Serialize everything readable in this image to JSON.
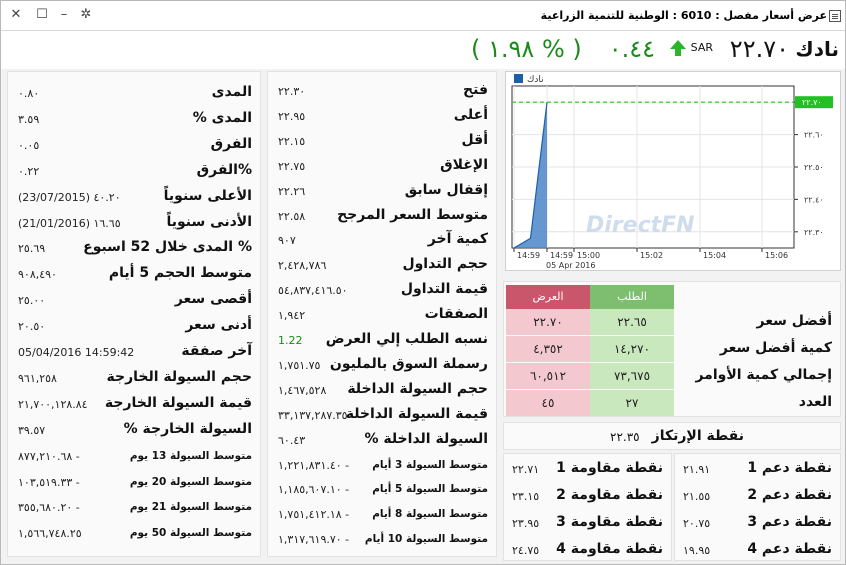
{
  "window": {
    "title": "عرض أسعار مفصل : 6010 : الوطنية للتنمية الزراعية",
    "icon": "grid-icon",
    "controls": [
      "settings-icon",
      "minimize-icon",
      "maximize-icon",
      "close-icon"
    ]
  },
  "header": {
    "name": "نادك",
    "price": "٢٢.٧٠",
    "currency": "SAR",
    "direction_icon": "up-arrow-icon",
    "change": "٠.٤٤",
    "change_pct": "( ١.٩٨ % )",
    "color_up": "#1a8a1a"
  },
  "middle": {
    "rows": [
      {
        "label": "فتح",
        "value": "٢٢.٣٠"
      },
      {
        "label": "أعلى",
        "value": "٢٢.٩٥"
      },
      {
        "label": "أقل",
        "value": "٢٢.١٥"
      },
      {
        "label": "الإغلاق",
        "value": "٢٢.٧٥"
      },
      {
        "label": "إقفال سابق",
        "value": "٢٢.٢٦"
      },
      {
        "label": "متوسط السعر المرجح",
        "value": "٢٢.٥٨"
      },
      {
        "label": "كمية آخر",
        "value": "٩٠٧"
      },
      {
        "label": "حجم التداول",
        "value": "٢,٤٢٨,٧٨٦"
      },
      {
        "label": "قيمة التداول",
        "value": "٥٤,٨٣٧,٤١٦.٥٠"
      },
      {
        "label": "الصفقات",
        "value": "١,٩٤٢"
      },
      {
        "label": "نسبه الطلب إلي العرض",
        "value": "1.22"
      },
      {
        "label": "رسملة السوق بالمليون",
        "value": "١,٧٥١.٧٥"
      },
      {
        "label": "حجم السيولة الداخلة",
        "value": "١,٤٦٧,٥٢٨"
      },
      {
        "label": "قيمة السيولة الداخلة",
        "value": "٣٣,١٣٧,٢٨٧.٣٥"
      },
      {
        "label": "% السيولة الداخلة",
        "value": "٦٠.٤٣"
      },
      {
        "label": "متوسط السيولة 3 أيام",
        "value": "١,٢٢١,٨٣١.٤٠ -"
      },
      {
        "label": "متوسط السيولة 5 أيام",
        "value": "١,١٨٥,٦٠٧.١٠ -"
      },
      {
        "label": "متوسط السيولة 8 أيام",
        "value": "١,٧٥١,٤١٢.١٨ -"
      },
      {
        "label": "متوسط السيولة 10 أيام",
        "value": "١,٣١٧,٦١٩.٧٠ -"
      }
    ]
  },
  "left": {
    "rows": [
      {
        "label": "المدى",
        "value": "٠.٨٠"
      },
      {
        "label": "% المدى",
        "value": "٣.٥٩"
      },
      {
        "label": "الفرق",
        "value": "٠.٠٥"
      },
      {
        "label": "الفرق%",
        "value": "٠.٢٢"
      },
      {
        "label": "الأعلى سنوياً",
        "value": "(23/07/2015) ٤٠.٢٠"
      },
      {
        "label": "الأدنى سنوياً",
        "value": "(21/01/2016) ١٦.٦٥"
      },
      {
        "label": "المدى خلال 52 اسبوع %",
        "value": "٢٥.٦٩"
      },
      {
        "label": "متوسط الحجم 5 أيام",
        "value": "٩٠٨,٤٩٠"
      },
      {
        "label": "أقصى سعر",
        "value": "٢٥.٠٠"
      },
      {
        "label": "أدنى سعر",
        "value": "٢٠.٥٠"
      },
      {
        "label": "آخر صفقة",
        "value": "05/04/2016 14:59:42"
      },
      {
        "label": "حجم السيولة الخارجة",
        "value": "٩٦١,٢٥٨"
      },
      {
        "label": "قيمة السيولة الخارجة",
        "value": "٢١,٧٠٠,١٢٨.٨٤"
      },
      {
        "label": "% السيولة الخارجة",
        "value": "٣٩.٥٧"
      },
      {
        "label": "متوسط السيولة 13 يوم",
        "value": "٨٧٧,٢١٠.٦٨ -"
      },
      {
        "label": "متوسط السيولة 20 يوم",
        "value": "١٠٣,٥١٩.٣٣ -"
      },
      {
        "label": "متوسط السيولة 21 يوم",
        "value": "٣٥٥,٦٨٠.٢٠ -"
      },
      {
        "label": "متوسط السيولة 50 يوم",
        "value": "١,٥٦٦,٧٤٨.٢٥"
      }
    ]
  },
  "chart_data": {
    "type": "area",
    "legend": "نادك",
    "watermark": "DirectFN",
    "date_label": "05 Apr 2016",
    "x_ticks": [
      "14:59",
      "14:59",
      "15:00",
      "15:02",
      "15:04",
      "15:06"
    ],
    "y_ticks": [
      "٢٢.٣٠",
      "٢٢.٤٠",
      "٢٢.٥٠",
      "٢٢.٦٠",
      "٢٢.٧٠"
    ],
    "ylim": [
      22.25,
      22.75
    ],
    "last_price_label": "٢٢.٧٠",
    "points": [
      [
        0,
        22.25
      ],
      [
        1,
        22.28
      ],
      [
        2,
        22.7
      ]
    ],
    "reference_line": 22.7,
    "colors": {
      "area": "#4a86c8",
      "line": "#1d5fa8",
      "ref": "#2ec02e",
      "tag": "#22c022"
    }
  },
  "book": {
    "bid_header": "الطلب",
    "ask_header": "العرض",
    "bid_color": "#7dbf6f",
    "ask_color": "#c9566b",
    "rows": [
      {
        "label": "أفضل سعر",
        "bid": "٢٢.٦٥",
        "ask": "٢٢.٧٠"
      },
      {
        "label": "كمية أفضل سعر",
        "bid": "١٤,٢٧٠",
        "ask": "٤,٣٥٢"
      },
      {
        "label": "إجمالي كمية الأوامر",
        "bid": "٧٣,٦٧٥",
        "ask": "٦٠,٥١٢"
      },
      {
        "label": "العدد",
        "bid": "٢٧",
        "ask": "٤٥"
      }
    ]
  },
  "pivot": {
    "label": "نقطة الإرتكاز",
    "value": "٢٢.٣٥"
  },
  "support": [
    {
      "label": "نقطة دعم 1",
      "value": "٢١.٩١"
    },
    {
      "label": "نقطة دعم 2",
      "value": "٢١.٥٥"
    },
    {
      "label": "نقطة دعم 3",
      "value": "٢٠.٧٥"
    },
    {
      "label": "نقطة دعم 4",
      "value": "١٩.٩٥"
    }
  ],
  "resistance": [
    {
      "label": "نقطة مقاومة 1",
      "value": "٢٢.٧١"
    },
    {
      "label": "نقطة مقاومة 2",
      "value": "٢٣.١٥"
    },
    {
      "label": "نقطة مقاومة 3",
      "value": "٢٣.٩٥"
    },
    {
      "label": "نقطة مقاومة 4",
      "value": "٢٤.٧٥"
    }
  ]
}
